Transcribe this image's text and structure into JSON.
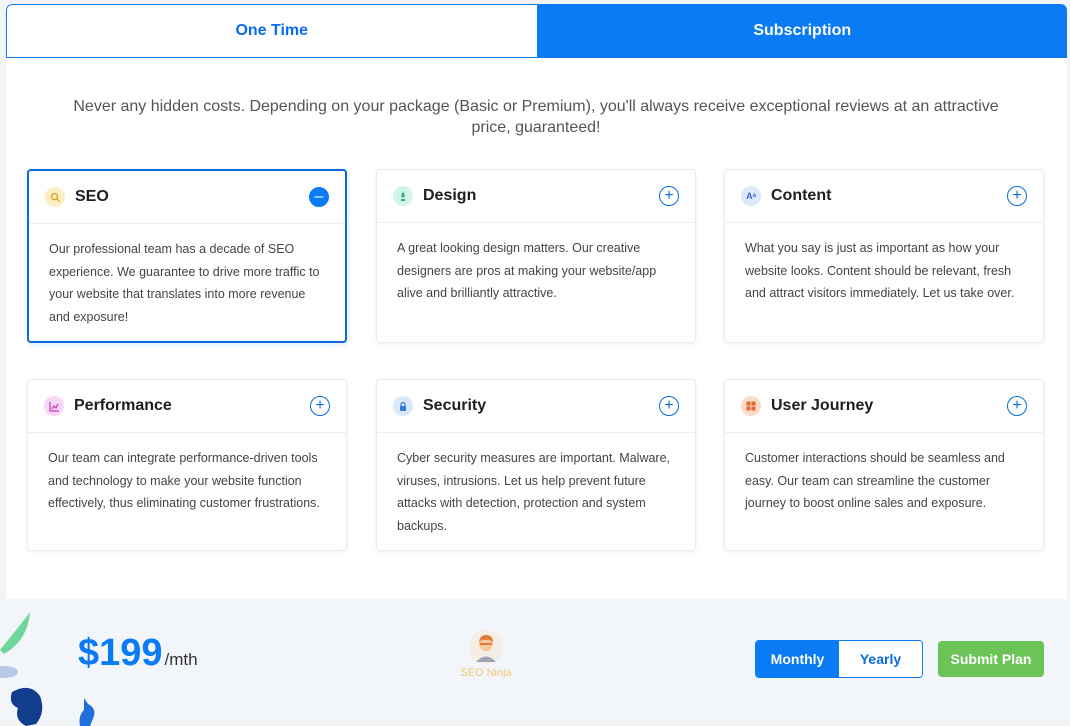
{
  "tabs": {
    "one_time": "One Time",
    "subscription": "Subscription"
  },
  "intro": "Never any hidden costs. Depending on your package (Basic or Premium), you'll always receive exceptional reviews at an attractive price, guaranteed!",
  "cards": [
    {
      "title": "SEO",
      "icon": "search-icon",
      "icon_color": "#f7d774",
      "expanded": true,
      "body": "Our professional team has a decade of SEO experience. We guarantee to drive more traffic to your website that translates into more revenue and exposure!"
    },
    {
      "title": "Design",
      "icon": "pen-icon",
      "icon_color": "#5ed3b0",
      "expanded": false,
      "body": "A great looking design matters. Our creative designers are pros at making your website/app alive and brilliantly attractive."
    },
    {
      "title": "Content",
      "icon": "text-icon",
      "icon_color": "#8fb3ef",
      "expanded": false,
      "body": "What you say is just as important as how your website looks. Content should be relevant, fresh and attract visitors immediately. Let us take over."
    },
    {
      "title": "Performance",
      "icon": "chart-icon",
      "icon_color": "#e58ae0",
      "expanded": false,
      "body": "Our team can integrate performance-driven tools and technology to make your website function effectively, thus eliminating customer frustrations."
    },
    {
      "title": "Security",
      "icon": "lock-icon",
      "icon_color": "#79b6f0",
      "expanded": false,
      "body": "Cyber security measures are important. Malware, viruses, intrusions. Let us help prevent future attacks with detection, protection and system backups."
    },
    {
      "title": "User Journey",
      "icon": "grid-icon",
      "icon_color": "#f0976a",
      "expanded": false,
      "body": "Customer interactions should be seamless and easy. Our team can streamline the customer journey to boost online sales and exposure."
    }
  ],
  "price": {
    "amount": "$199",
    "unit": "/mth"
  },
  "plan_badge": {
    "label": "SEO Ninja",
    "icon": "ninja-avatar-icon"
  },
  "billing": {
    "monthly": "Monthly",
    "yearly": "Yearly",
    "selected": "Monthly"
  },
  "submit_label": "Submit Plan",
  "colors": {
    "accent": "#0a7af5",
    "submit": "#6cc459"
  }
}
